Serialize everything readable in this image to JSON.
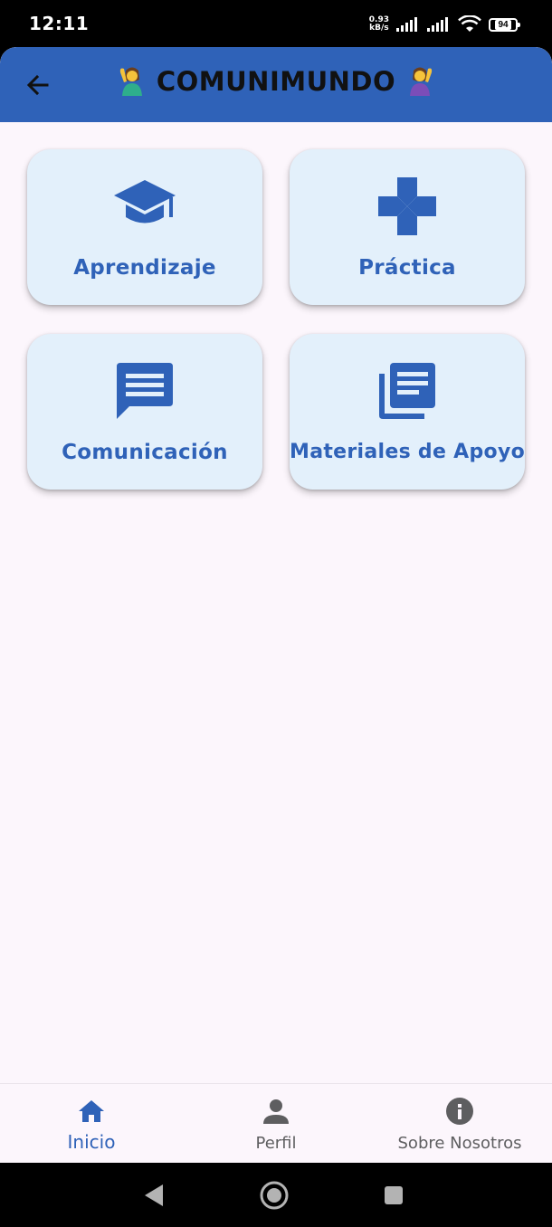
{
  "status_bar": {
    "time": "12:11",
    "net_speed_value": "0.93",
    "net_speed_unit": "kB/s",
    "battery": "94"
  },
  "app_bar": {
    "title": "COMUNIMUNDO",
    "back_icon": "arrow-left-icon",
    "emoji": "person-gesturing-ok-emoji",
    "bg_color": "#2f62b8"
  },
  "cards": [
    {
      "label": "Aprendizaje",
      "icon": "graduation-cap-icon"
    },
    {
      "label": "Práctica",
      "icon": "gamepad-dpad-icon"
    },
    {
      "label": "Comunicación",
      "icon": "chat-message-icon"
    },
    {
      "label": "Materiales de Apoyo",
      "icon": "library-books-icon"
    }
  ],
  "bottom_nav": {
    "items": [
      {
        "label": "Inicio",
        "icon": "home-icon",
        "active": true
      },
      {
        "label": "Perfil",
        "icon": "person-icon",
        "active": false
      },
      {
        "label": "Sobre Nosotros",
        "icon": "info-icon",
        "active": false
      }
    ]
  },
  "colors": {
    "accent": "#2f62b8",
    "card_bg": "#e3f0fb",
    "page_bg": "#fcf6fc"
  }
}
